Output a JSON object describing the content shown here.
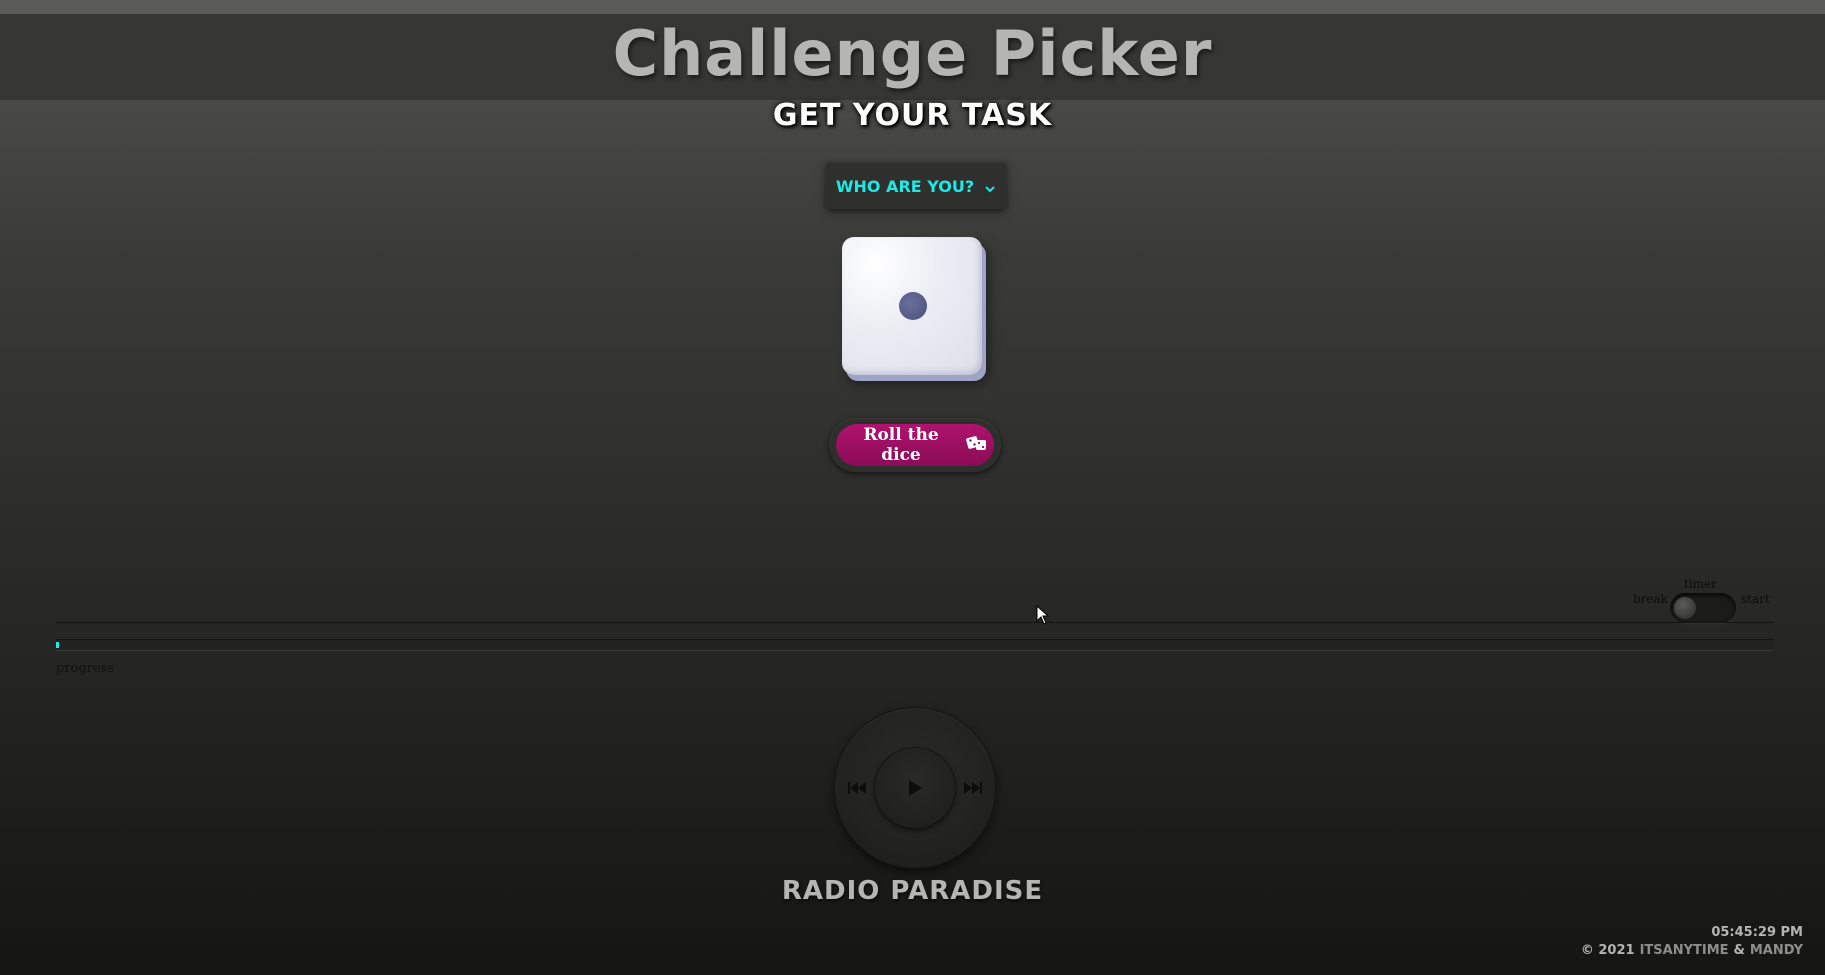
{
  "header": {
    "title": "Challenge Picker",
    "subtitle": "GET YOUR TASK"
  },
  "player_select": {
    "label": "WHO ARE YOU?",
    "icon": "chevron-down-icon",
    "accent_color": "#1de9e6"
  },
  "dice": {
    "face_value": 1,
    "roll_label": "Roll the dice",
    "roll_icon": "dice-icon",
    "button_color": "#a0106a"
  },
  "timer": {
    "title": "timer",
    "left_label": "break",
    "right_label": "start",
    "state": "break"
  },
  "progress": {
    "label": "progress",
    "value_percent": 0.2
  },
  "radio": {
    "station": "RADIO PARADISE",
    "controls": [
      "previous-icon",
      "play-icon",
      "next-icon"
    ]
  },
  "footer": {
    "time": "05:45:29 PM",
    "copyright": "© 2021",
    "author1": "ITSANYTIME",
    "separator": "&",
    "author2": "MANDY"
  }
}
